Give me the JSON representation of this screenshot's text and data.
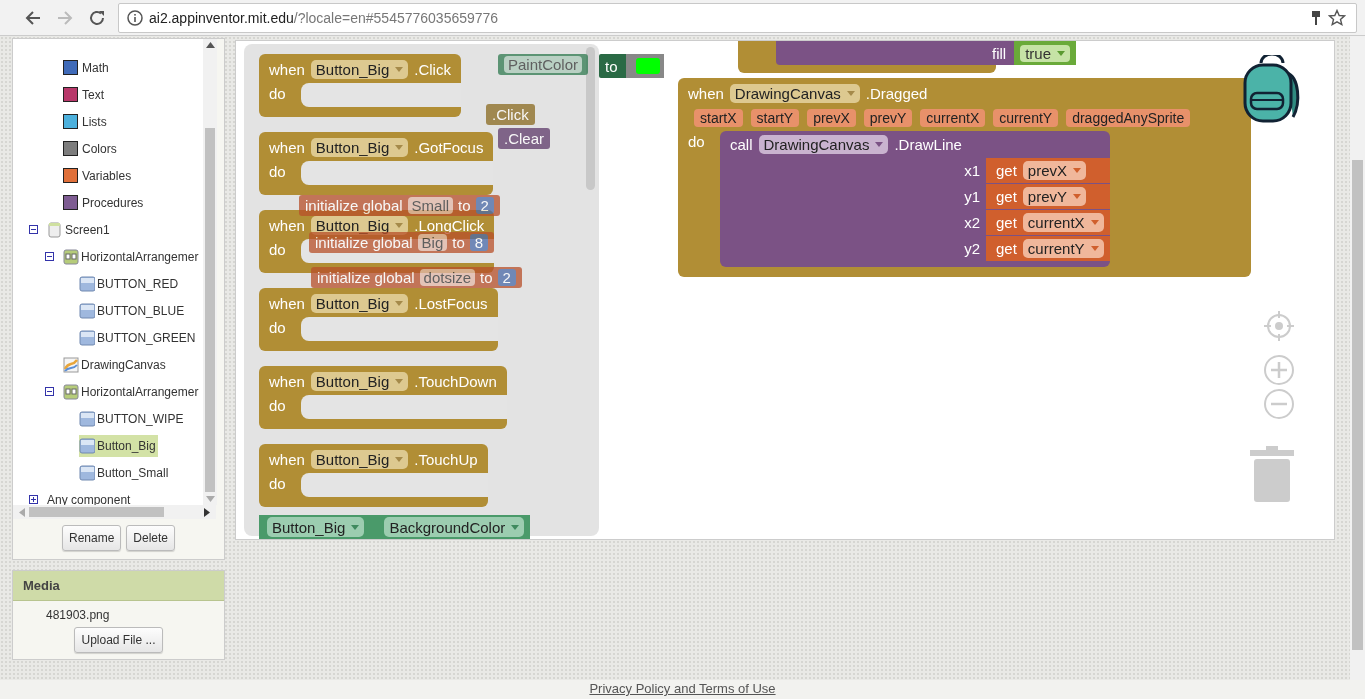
{
  "browser": {
    "url_host": "ai2.appinventor.mit.edu",
    "url_rest": "/?locale=en#5545776035659776"
  },
  "sidebar": {
    "builtins": [
      {
        "label": "Math",
        "color": "#3f6ab8"
      },
      {
        "label": "Text",
        "color": "#b8386a"
      },
      {
        "label": "Lists",
        "color": "#4cb0dc"
      },
      {
        "label": "Colors",
        "color": "#7d7d7d"
      },
      {
        "label": "Variables",
        "color": "#e0703a"
      },
      {
        "label": "Procedures",
        "color": "#7e5c92"
      }
    ],
    "tree": [
      {
        "label": "Screen1",
        "kind": "screen",
        "expanded": true,
        "selected": false,
        "children": [
          {
            "label": "HorizontalArrangemer",
            "kind": "arrangement",
            "expanded": true,
            "selected": false,
            "children": [
              {
                "label": "BUTTON_RED",
                "kind": "button",
                "selected": false
              },
              {
                "label": "BUTTON_BLUE",
                "kind": "button",
                "selected": false
              },
              {
                "label": "BUTTON_GREEN",
                "kind": "button",
                "selected": false
              }
            ]
          },
          {
            "label": "DrawingCanvas",
            "kind": "canvas",
            "selected": false
          },
          {
            "label": "HorizontalArrangemer",
            "kind": "arrangement",
            "expanded": true,
            "selected": false,
            "children": [
              {
                "label": "BUTTON_WIPE",
                "kind": "button",
                "selected": false
              },
              {
                "label": "Button_Big",
                "kind": "button",
                "selected": true
              },
              {
                "label": "Button_Small",
                "kind": "button",
                "selected": false
              }
            ]
          }
        ]
      }
    ],
    "any_component": {
      "label": "Any component",
      "expanded": false
    },
    "buttons": [
      "Rename",
      "Delete"
    ]
  },
  "media": {
    "title": "Media",
    "files": [
      "481903.png"
    ],
    "upload_button": "Upload File ..."
  },
  "workspace": {
    "background_blocks": [
      {
        "kind": "property",
        "label": "PaintColor"
      },
      {
        "kind": "event",
        "label": ".Click"
      },
      {
        "kind": "method",
        "label": ".Clear"
      },
      {
        "kind": "global",
        "keyword": "initialize global",
        "name": "Small",
        "to": "to",
        "value": "2"
      },
      {
        "kind": "global",
        "keyword": "initialize global",
        "name": "Big",
        "to": "to",
        "value": "8"
      },
      {
        "kind": "global",
        "keyword": "initialize global",
        "name": "dotsize",
        "to": "to",
        "value": "2"
      }
    ],
    "color_setter": {
      "keyword": "to",
      "color": "#00ff00"
    },
    "flyout": {
      "events": [
        {
          "when": "when",
          "component": "Button_Big",
          "event": ".Click",
          "do": "do"
        },
        {
          "when": "when",
          "component": "Button_Big",
          "event": ".GotFocus",
          "do": "do"
        },
        {
          "when": "when",
          "component": "Button_Big",
          "event": ".LongClick",
          "do": "do"
        },
        {
          "when": "when",
          "component": "Button_Big",
          "event": ".LostFocus",
          "do": "do"
        },
        {
          "when": "when",
          "component": "Button_Big",
          "event": ".TouchDown",
          "do": "do"
        },
        {
          "when": "when",
          "component": "Button_Big",
          "event": ".TouchUp",
          "do": "do"
        }
      ],
      "setter": {
        "component": "Button_Big",
        "property": "BackgroundColor"
      }
    },
    "top_block": {
      "label": "fill",
      "value": "true"
    },
    "dragged": {
      "when": "when",
      "component": "DrawingCanvas",
      "event": ".Dragged",
      "do": "do",
      "params": [
        "startX",
        "startY",
        "prevX",
        "prevY",
        "currentX",
        "currentY",
        "draggedAnySprite"
      ],
      "call": {
        "keyword": "call",
        "component": "DrawingCanvas",
        "method": ".DrawLine",
        "args": [
          {
            "name": "x1",
            "get": "get",
            "var": "prevX"
          },
          {
            "name": "y1",
            "get": "get",
            "var": "prevY"
          },
          {
            "name": "x2",
            "get": "get",
            "var": "currentX"
          },
          {
            "name": "y2",
            "get": "get",
            "var": "currentY"
          }
        ]
      }
    }
  },
  "footer": {
    "link": "Privacy Policy and Terms of Use"
  }
}
